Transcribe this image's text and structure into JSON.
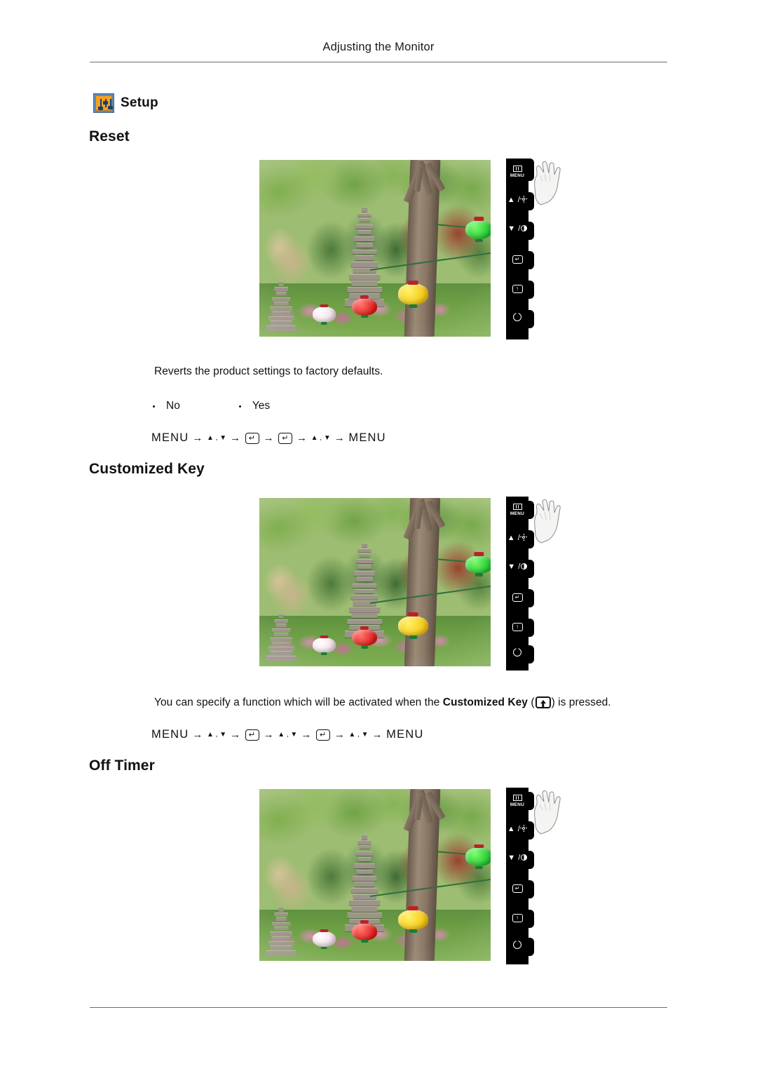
{
  "page": {
    "header_title": "Adjusting the Monitor",
    "setup_label": "Setup",
    "setup_icon": "setup-sliders-icon"
  },
  "sections": [
    {
      "heading": "Reset",
      "description": "Reverts the product settings to factory defaults.",
      "options": [
        "No",
        "Yes"
      ],
      "sequence": [
        "MENU",
        "▲ , ▼",
        "↵",
        "↵",
        "▲ , ▼",
        "MENU"
      ]
    },
    {
      "heading": "Customized Key",
      "description_before": "You can specify a function which will be activated when the ",
      "description_bold": "Customized Key",
      "description_after": " is pressed.",
      "inline_icon": "customized-key-icon",
      "sequence": [
        "MENU",
        "▲ , ▼",
        "↵",
        "▲ , ▼",
        "↵",
        "▲ , ▼",
        "MENU"
      ]
    },
    {
      "heading": "Off Timer"
    }
  ],
  "control_panel": {
    "buttons": [
      {
        "name": "menu-button",
        "label": "MENU",
        "icon": "menu-grid-icon"
      },
      {
        "name": "up-brightness-button",
        "label": "▲ /",
        "icon": "brightness-sun-icon"
      },
      {
        "name": "down-contrast-button",
        "label": "▼ /",
        "icon": "contrast-circle-icon"
      },
      {
        "name": "enter-button",
        "label": "↵",
        "icon": "enter-icon"
      },
      {
        "name": "source-button",
        "label": "↑",
        "icon": "source-up-icon"
      },
      {
        "name": "power-button",
        "label": "",
        "icon": "power-icon"
      }
    ],
    "hand_pointer": "hand-pointing-icon"
  },
  "photo": {
    "alt": "Korean temple garden with stone pagoda, trees and colored paper lanterns",
    "lanterns": [
      {
        "color": "green",
        "hex": "#21c42e"
      },
      {
        "color": "yellow",
        "hex": "#f2c310"
      },
      {
        "color": "red",
        "hex": "#e01b1b"
      },
      {
        "color": "white",
        "hex": "#f2d9e4"
      }
    ]
  },
  "colors": {
    "rule": "#6d6d6d",
    "setup_icon_bg": "#f0a326",
    "setup_icon_border": "#5b87b5",
    "text": "#111111"
  }
}
